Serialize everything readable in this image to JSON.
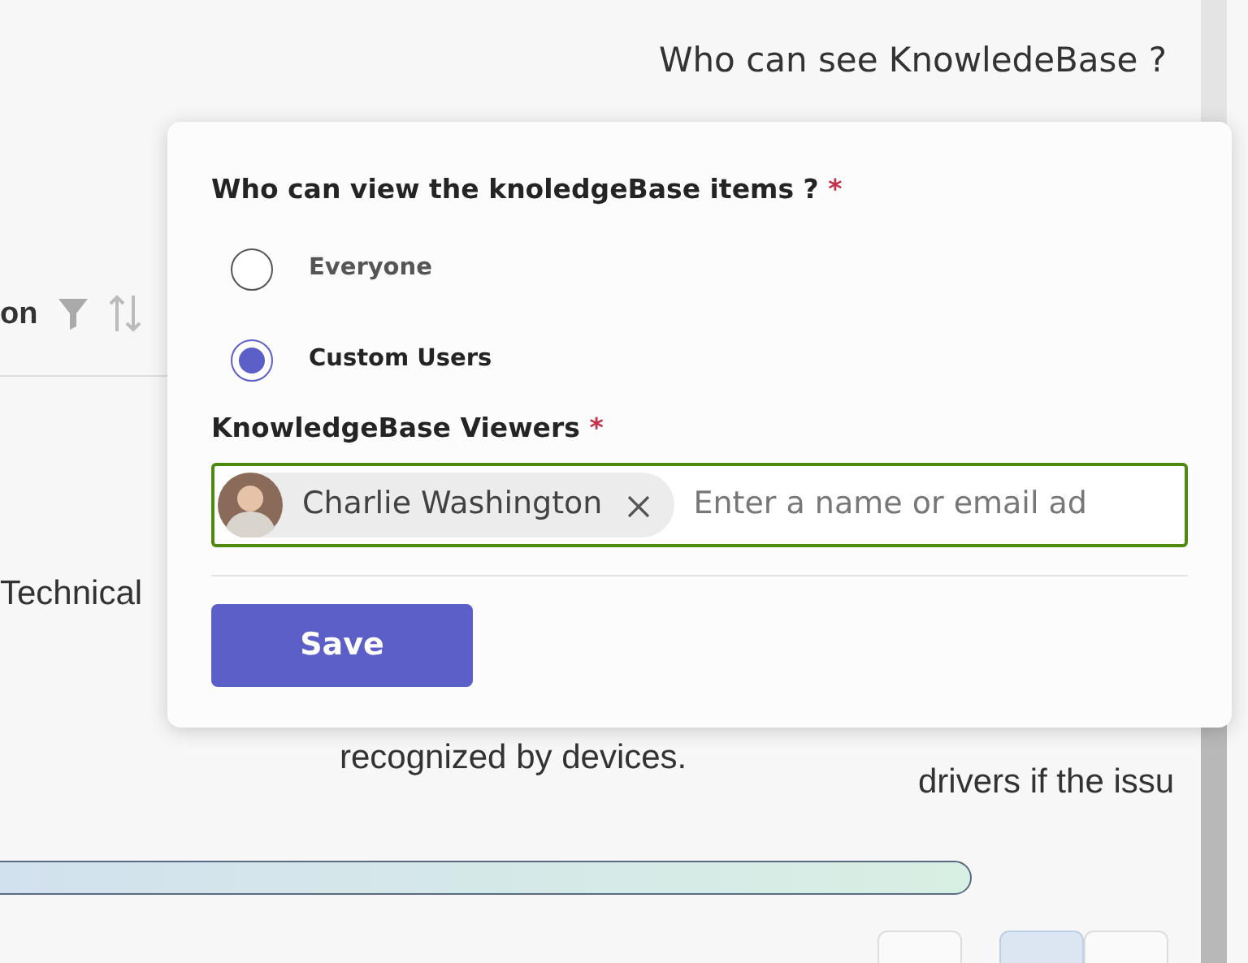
{
  "page": {
    "heading": "Who can see KnowledeBase ?",
    "column_header": "on",
    "cells": [
      "Technical",
      "recognized by devices.",
      "drivers if the issu"
    ],
    "pagination": [
      {
        "selected": false
      },
      {
        "selected": true
      },
      {
        "selected": false
      }
    ]
  },
  "popup": {
    "question": "Who can view the knoledgeBase items ?",
    "question_required": "*",
    "options": [
      {
        "label": "Everyone",
        "selected": false
      },
      {
        "label": "Custom Users",
        "selected": true
      }
    ],
    "viewers_label": "KnowledgeBase Viewers",
    "viewers_required": "*",
    "viewers": [
      {
        "name": "Charlie Washington"
      }
    ],
    "placeholder": "Enter a name or email ad",
    "save": "Save"
  }
}
